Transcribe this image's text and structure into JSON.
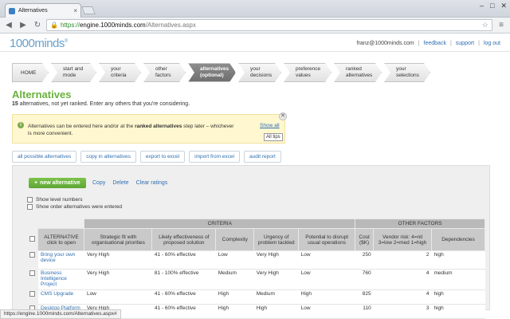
{
  "browser": {
    "tab_title": "Alternatives",
    "tab_close": "×",
    "url_scheme": "https://",
    "url_host": "engine.1000minds.com",
    "url_path": "/Alternatives.aspx",
    "window_buttons": [
      "–",
      "□",
      "✕"
    ],
    "status_url": "https://engine.1000minds.com/Alternatives.aspx#"
  },
  "header": {
    "logo": "1000minds",
    "logo_mark": "®",
    "user": "franz@1000minds.com",
    "links": [
      "feedback",
      "support",
      "log out"
    ]
  },
  "steps": [
    {
      "line1": "HOME",
      "line2": ""
    },
    {
      "line1": "start and",
      "line2": "mode"
    },
    {
      "line1": "your",
      "line2": "criteria"
    },
    {
      "line1": "other",
      "line2": "factors"
    },
    {
      "line1": "alternatives",
      "line2": "(optional)"
    },
    {
      "line1": "your",
      "line2": "decisions"
    },
    {
      "line1": "preference",
      "line2": "values"
    },
    {
      "line1": "ranked",
      "line2": "alternatives"
    },
    {
      "line1": "your",
      "line2": "selections"
    }
  ],
  "page": {
    "title": "Alternatives",
    "count": "15",
    "subtitle_rest": " alternatives, not yet ranked. Enter any others that you're considering."
  },
  "tip": {
    "icon": "i",
    "text_before": "Alternatives can be entered here and/or at the ",
    "text_bold": "ranked alternatives",
    "text_after": " step later – whichever is more convenient.",
    "show_all": "Show all",
    "close": "✕",
    "tooltip": "All tips"
  },
  "actions": [
    "all possible alternatives",
    "copy in alternatives",
    "export to excel",
    "import from excel",
    "audit report"
  ],
  "panel": {
    "new_alt": "new alternative",
    "links": [
      "Copy",
      "Delete",
      "Clear ratings"
    ],
    "show_level_numbers": "Show level numbers",
    "show_order": "Show order alternatives were entered"
  },
  "table": {
    "group_criteria": "CRITERIA",
    "group_other": "OTHER FACTORS",
    "col_alt_line1": "ALTERNATIVE",
    "col_alt_line2": "click to open",
    "criteria_cols": [
      "Strategic fit with organisational priorities",
      "Likely effectiveness of proposed solution",
      "Complexity",
      "Urgency of problem tackled",
      "Potential to disrupt usual operations"
    ],
    "other_cols": [
      "Cost ($K)",
      "Vendor risk: 4=nil 3=low 2=med 1=high",
      "Dependencies"
    ],
    "rows": [
      {
        "name": "Bring your own device",
        "c": [
          "Very High",
          "41 - 60% effective",
          "Low",
          "Very High",
          "Low"
        ],
        "o": [
          "250",
          "2",
          "high"
        ]
      },
      {
        "name": "Business Intelligence Project",
        "c": [
          "Very High",
          "81 - 100% effective",
          "Medium",
          "Very High",
          "Low"
        ],
        "o": [
          "760",
          "4",
          "medium"
        ]
      },
      {
        "name": "CMS Upgrade",
        "c": [
          "Low",
          "41 - 60% effective",
          "High",
          "Medium",
          "High"
        ],
        "o": [
          "825",
          "4",
          "high"
        ]
      },
      {
        "name": "Desktop Platform",
        "c": [
          "Very High",
          "41 - 60% effective",
          "High",
          "High",
          "Low"
        ],
        "o": [
          "110",
          "3",
          "high"
        ]
      }
    ]
  }
}
